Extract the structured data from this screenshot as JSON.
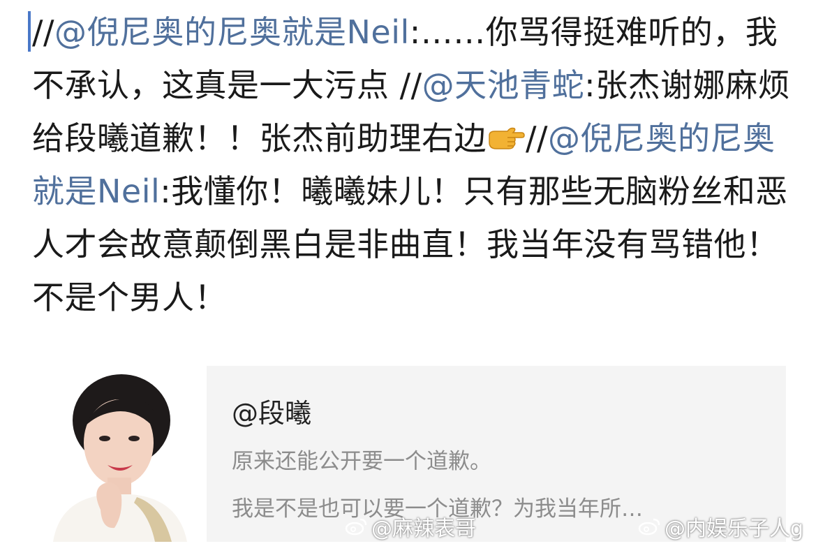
{
  "post": {
    "segments": [
      {
        "text": "//",
        "type": "plain"
      },
      {
        "text": "@倪尼奥的尼奥就是Neil",
        "type": "mention"
      },
      {
        "text": ":……你骂得挺难听的，我不承认，这真是一大污点 //",
        "type": "plain"
      },
      {
        "text": "@天池青蛇",
        "type": "mention"
      },
      {
        "text": ":张杰谢娜麻烦给段曦道歉！！张杰前助理右边",
        "type": "plain"
      },
      {
        "text": "pointing-right-emoji",
        "type": "emoji"
      },
      {
        "text": "//",
        "type": "plain"
      },
      {
        "text": "@倪尼奥的尼奥就是Neil",
        "type": "mention"
      },
      {
        "text": ":我懂你！曦曦妹儿！只有那些无脑粉丝和恶人才会故意颠倒黑白是非曲直！我当年没有骂错他！不是个男人！",
        "type": "plain"
      }
    ]
  },
  "card": {
    "username": "@段曦",
    "line1": "原来还能公开要一个道歉。",
    "line2": "我是不是也可以要一个道歉？为我当年所…"
  },
  "watermarks": {
    "left": "@麻辣表哥",
    "right": "@内娱乐子人g",
    "icon": "weibo-icon"
  },
  "colors": {
    "mention": "#50709c",
    "caret": "#4a78c8",
    "card_bg": "#f4f4f4",
    "card_text": "#8c8c8c"
  }
}
